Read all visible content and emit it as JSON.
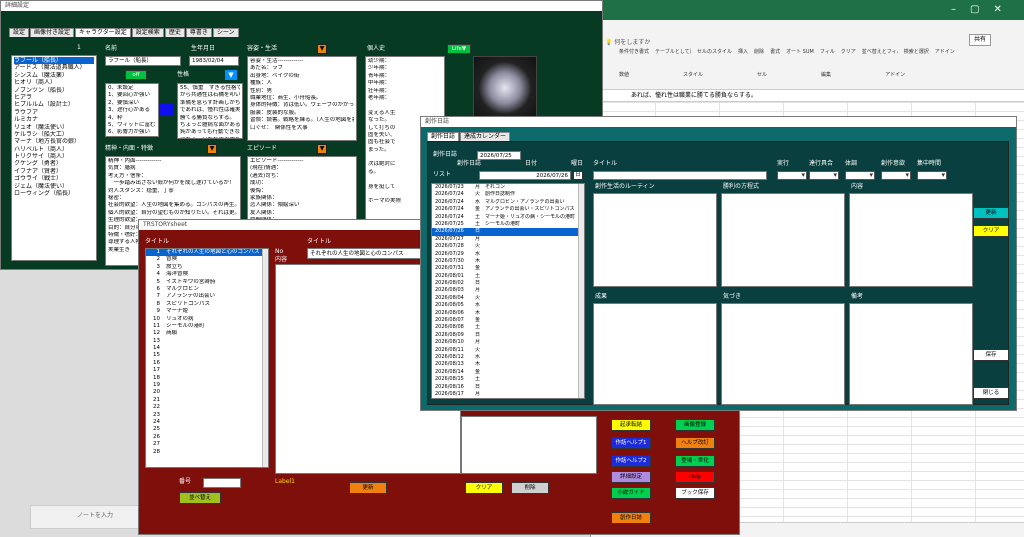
{
  "excel": {
    "ribbon_tabs": [
      "ファイル",
      "ホーム",
      "挿入",
      "描画",
      "ページ レイアウト",
      "数式",
      "データ",
      "校閲",
      "表示",
      "ヘルプ"
    ],
    "search_hint": "何をしますか",
    "share": "共有",
    "groups": [
      "数値",
      "スタイル",
      "セル",
      "編集",
      "アドイン"
    ],
    "btns": [
      "条件付き書式",
      "テーブルとして書式設定",
      "セルのスタイル",
      "挿入",
      "削除",
      "書式",
      "オート SUM",
      "フィル",
      "クリア",
      "並べ替えとフィルター",
      "検索と選択",
      "アドイン"
    ],
    "formula": "あれば、憧れ性は職業に勝てる勝負ならする。",
    "bottom_note": "ノートを入力"
  },
  "detail": {
    "title": "詳細設定",
    "tabs": [
      "設定",
      "画像付き設定",
      "キャラクター設定",
      "設定検索",
      "歴史",
      "尊書き",
      "シーン"
    ],
    "list_no": "1",
    "chars": [
      "ラフール（船長）",
      "アードス（魔法道具職人）",
      "シンスム（魔法薬）",
      "ヒオリ（商人）",
      "ノブンツン（船長）",
      "ヒアラ",
      "ヒプルルム（設計士）",
      "ラウフア",
      "ルミカナ",
      "リュオ（魔法使い）",
      "ケルラシ（船大工）",
      "マーナ（地方長官の娘）",
      "ハリベルト（商人）",
      "トリクサイ（商人）",
      "クケング（勇者）",
      "イフナア（賢者）",
      "ゴウライ（戦士）",
      "ジェム（魔法使い）",
      "ローウィング（船長）"
    ],
    "name_label": "名前",
    "name_value": "ラフール（船長）",
    "birth_label": "生年月日",
    "birth_value": "1983/02/04",
    "appearance_label": "容姿・生活",
    "appearance_lines": [
      "容姿・生活-------------",
      "あだ名：ラフ",
      "出身地：ベイクの街",
      "種族：人",
      "性別：男",
      "職業地位：商生、小舟船長。",
      "身体的特徴：背は低い。ウェーブのかかった長髪。ポニーテール",
      "服装：皮装的な服。",
      "習慣：読書。戦略を練る。（人生の地図を書く）",
      "口ぐせ：　関係性を大事"
    ],
    "history_label": "個人史",
    "life_btn": "Life",
    "history_lines": [
      "幼少期：",
      "少年期：",
      "青年期：",
      "中年期：",
      "壮年期：",
      "老年期：",
      "",
      "変える人生",
      "なった。",
      "して打ちの",
      "固を失い、",
      "固も社会で",
      "まった。",
      "",
      "次は絶対に",
      "る。",
      "",
      "身を挺して",
      "",
      "ホーマの実際"
    ],
    "off_btn": "off",
    "personality_label": "性格",
    "scale_lines": [
      "0、未設定",
      "1、要回心が強い",
      "2、要慎深い",
      "3、途行心がある",
      "4、粋",
      "5、ウィットに富む",
      "6、影響力が強い"
    ],
    "personality_lines": [
      "55、慎重　すぎる性格で",
      "から共通性は石橋を叩いて",
      "準備を怠らず計画しがち。",
      "であれば、憧れ性は確実に",
      "勝てる勝負ならする。",
      "ちょっと臆病な面がある。慎",
      "鈍があっても行動できない。",
      "になる　何かれす事実を"
    ],
    "spirit_label": "精神・内面・特徴",
    "spirit_lines": [
      "精神・内面-------------",
      "気質：膳病",
      "考え方・信条：",
      "　一歩踏み出さない殻が何かを成し遂げているか！",
      "対人スタンス：穏重、丁寧",
      "秘密：",
      "社会的欲望：人生の地図を集める。コンパスの再生。",
      "個人的欲望：自分の望むものが知りたい。それは更。",
      "生理的欲望：",
      "目的：自分の",
      "特徴・嗜好：",
      "尊理する人物",
      "実業生き"
    ],
    "episode_label": "エピソード",
    "episode_lines": [
      "エピソード-------------",
      "(現在)情遇：",
      "(過去)苛ち：",
      "成功：",
      "後悔：",
      "家族関係：",
      "恋人関係：傾絵深い",
      "友人関係：",
      "仲間関係："
    ]
  },
  "story": {
    "title": "TRSTORYsheet",
    "title_label": "タイトル",
    "no_label": "No",
    "content_label": "内容",
    "selected_title": "それぞれの人生の地図と心のコンパス",
    "list": [
      "それぞれの人生の地図と心のコンパス",
      "冒険",
      "旅立ち",
      "海洋冒険",
      "イストキワの宮蒔詩",
      "マルグロビン",
      "アノランテの出会い",
      "スピリトコンパス",
      "マーナ姫",
      "リュオの病",
      "シーモルの港町",
      "商願",
      "",
      "",
      "",
      "",
      "",
      "",
      "",
      "",
      "",
      "",
      "",
      "",
      "",
      "",
      "",
      ""
    ],
    "number_label": "番号",
    "label1": "Label1",
    "sort_btn": "並べ替え",
    "update_btn": "更新",
    "clear_btn": "クリア",
    "delete_btn": "削除",
    "side_btns": [
      {
        "label": "起承転結",
        "bg": "#ffff00"
      },
      {
        "label": "画像登録",
        "bg": "#00d050"
      },
      {
        "label": "作話ヘルプ1",
        "bg": "#1c2cdc"
      },
      {
        "label": "ヘルプ改訂",
        "bg": "#f08010"
      },
      {
        "label": "作話ヘルプ2",
        "bg": "#1c2cdc"
      },
      {
        "label": "登場・世化",
        "bg": "#00d050"
      },
      {
        "label": "詳細設定",
        "bg": "#b08ce0"
      },
      {
        "label": "Help",
        "bg": "#ff0000"
      },
      {
        "label": "小説ガイド",
        "bg": "#00d050"
      },
      {
        "label": "ブック保存",
        "bg": "#ffffff"
      },
      {
        "label": "創作日誌",
        "bg": "#f08010"
      }
    ]
  },
  "diary": {
    "title": "創作日誌",
    "tabs": [
      "創作日誌",
      "達成カレンダー"
    ],
    "date_label": "創作日誌",
    "date_value": "2026/07/25",
    "date_col": "創作日誌",
    "day_col": "日付",
    "week_col": "曜日",
    "list_label": "リスト",
    "date2": "2026/07/26",
    "cal_btn": "日",
    "title_col": "タイトル",
    "cols": [
      "実行",
      "達行具合",
      "体調",
      "創作意欲",
      "集中時間"
    ],
    "rows": [
      [
        "2026/07/23",
        "月",
        "それコン"
      ],
      [
        "2026/07/24",
        "火",
        "創作日誌制作"
      ],
      [
        "2026/07/24",
        "水",
        "マルグロビン・アノランテの出会い"
      ],
      [
        "2026/07/24",
        "金",
        "アノランテの出会い・スピリトコンパス"
      ],
      [
        "2026/07/24",
        "土",
        "マーナ姫・リュオの病・シーモルの港町"
      ],
      [
        "2026/07/25",
        "土",
        "シーモルの港町"
      ],
      [
        "2026/07/26",
        "日",
        ""
      ],
      [
        "2026/07/27",
        "月",
        ""
      ],
      [
        "2026/07/28",
        "火",
        ""
      ],
      [
        "2026/07/29",
        "水",
        ""
      ],
      [
        "2026/07/30",
        "木",
        ""
      ],
      [
        "2026/07/31",
        "金",
        ""
      ],
      [
        "2026/08/01",
        "土",
        ""
      ],
      [
        "2026/08/02",
        "日",
        ""
      ],
      [
        "2026/08/03",
        "月",
        ""
      ],
      [
        "2026/08/04",
        "火",
        ""
      ],
      [
        "2026/08/05",
        "水",
        ""
      ],
      [
        "2026/08/06",
        "木",
        ""
      ],
      [
        "2026/08/07",
        "金",
        ""
      ],
      [
        "2026/08/08",
        "土",
        ""
      ],
      [
        "2026/08/09",
        "日",
        ""
      ],
      [
        "2026/08/10",
        "月",
        ""
      ],
      [
        "2026/08/11",
        "火",
        ""
      ],
      [
        "2026/08/12",
        "水",
        ""
      ],
      [
        "2026/08/13",
        "木",
        ""
      ],
      [
        "2026/08/14",
        "金",
        ""
      ],
      [
        "2026/08/15",
        "土",
        ""
      ],
      [
        "2026/08/16",
        "日",
        ""
      ],
      [
        "2026/08/17",
        "月",
        ""
      ],
      [
        "2026/08/18",
        "火",
        ""
      ],
      [
        "2026/08/19",
        "水",
        ""
      ]
    ],
    "routine_label": "創作生活のルーティン",
    "method_label": "勝利の方程式",
    "content_label": "内容",
    "result_label": "成果",
    "notice_label": "気づき",
    "remarks_label": "備考",
    "update_btn": "更新",
    "clear_btn": "クリア",
    "save_btn": "保存",
    "close_btn": "閉じる"
  },
  "colors": {
    "detail_bg": "#063a22",
    "story_bg": "#7e0f0a",
    "diary_bg": "#0d6a6a",
    "accent": "#f08010"
  }
}
